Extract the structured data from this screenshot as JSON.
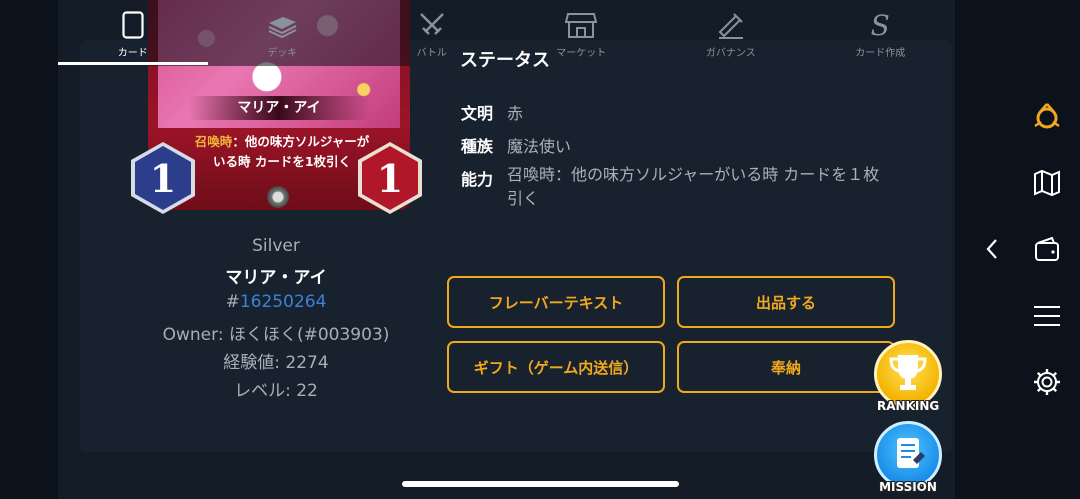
{
  "nav": {
    "items": [
      {
        "label": "カード",
        "icon": "card-icon",
        "active": true
      },
      {
        "label": "デッキ",
        "icon": "deck-icon",
        "active": false
      },
      {
        "label": "バトル",
        "icon": "battle-icon",
        "active": false
      },
      {
        "label": "マーケット",
        "icon": "market-icon",
        "active": false
      },
      {
        "label": "ガバナンス",
        "icon": "governance-icon",
        "active": false
      },
      {
        "label": "カード作成",
        "icon": "card-create-icon",
        "active": false
      }
    ]
  },
  "card": {
    "art_name": "マリア・アイ",
    "ability_highlight": "召喚時",
    "ability_rest": "：他の味方ソルジャーがいる時 カードを1枚引く",
    "cost": "1",
    "power": "1",
    "rarity": "Silver",
    "name": "マリア・アイ",
    "id_prefix": "#",
    "id_number": "16250264",
    "owner": "Owner: ほくほく(#003903)",
    "exp": "経験値: 2274",
    "level": "レベル: 22"
  },
  "status": {
    "title": "ステータス",
    "rows": [
      {
        "key": "文明",
        "value": "赤"
      },
      {
        "key": "種族",
        "value": "魔法使い"
      },
      {
        "key": "能力",
        "value": "召喚時：他の味方ソルジャーがいる時 カードを１枚引く"
      }
    ]
  },
  "actions": {
    "flavor": "フレーバーテキスト",
    "list": "出品する",
    "gift": "ギフト（ゲーム内送信）",
    "offer": "奉納"
  },
  "badges": {
    "ranking": "RANKING",
    "mission": "MISSION"
  },
  "colors": {
    "accent": "#f0a81c",
    "link": "#3b82d6",
    "cost_gem": "#2c3d8c",
    "power_gem": "#b0182a"
  }
}
